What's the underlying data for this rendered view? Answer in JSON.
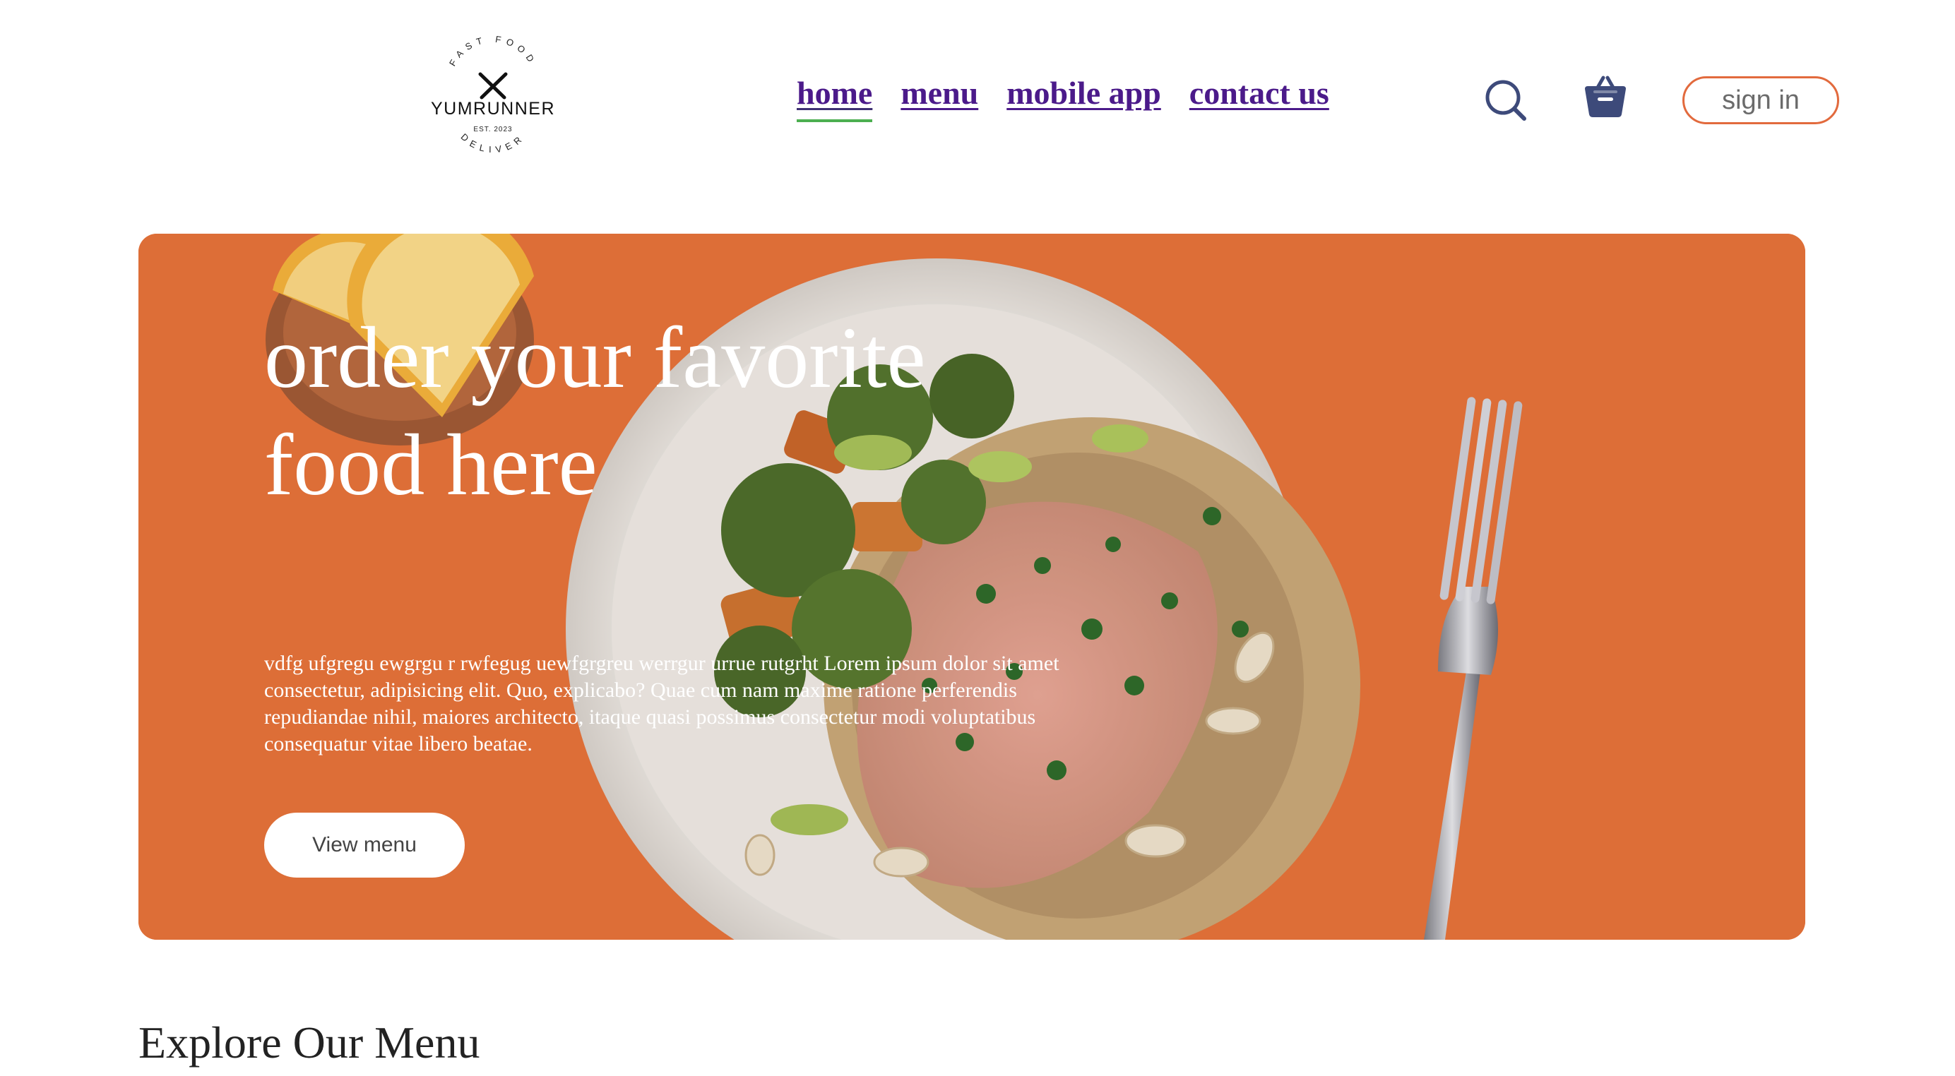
{
  "logo": {
    "top_text": "FAST FOOD",
    "brand": "YUMRUNNER",
    "est": "EST. 2023",
    "bottom_text": "DELIVER"
  },
  "nav": {
    "links": [
      {
        "label": "home",
        "active": true
      },
      {
        "label": "menu",
        "active": false
      },
      {
        "label": "mobile app",
        "active": false
      },
      {
        "label": "contact us",
        "active": false
      }
    ],
    "search_icon": "search-icon",
    "cart_icon": "basket-icon",
    "signin_label": "sign in"
  },
  "hero": {
    "title_line1": "order your favorite",
    "title_line2": "food here",
    "text": "vdfg ufgregu ewgrgu r rwfegug uewfgrgreu werrgur urrue rutgrht Lorem ipsum dolor sit amet consectetur, adipisicing elit. Quo, explicabo? Quae cum nam maxime ratione perferendis repudiandae nihil, maiores architecto, itaque quasi possimus consectetur modi voluptatibus consequatur vitae libero beatae.",
    "button_label": "View menu"
  },
  "section": {
    "title": "Explore Our Menu"
  },
  "colors": {
    "accent": "#e26a3d",
    "hero_bg": "#e7733a",
    "nav_link": "#4b1a8a",
    "active_underline": "#4caf50",
    "icon": "#3d4a7a"
  }
}
